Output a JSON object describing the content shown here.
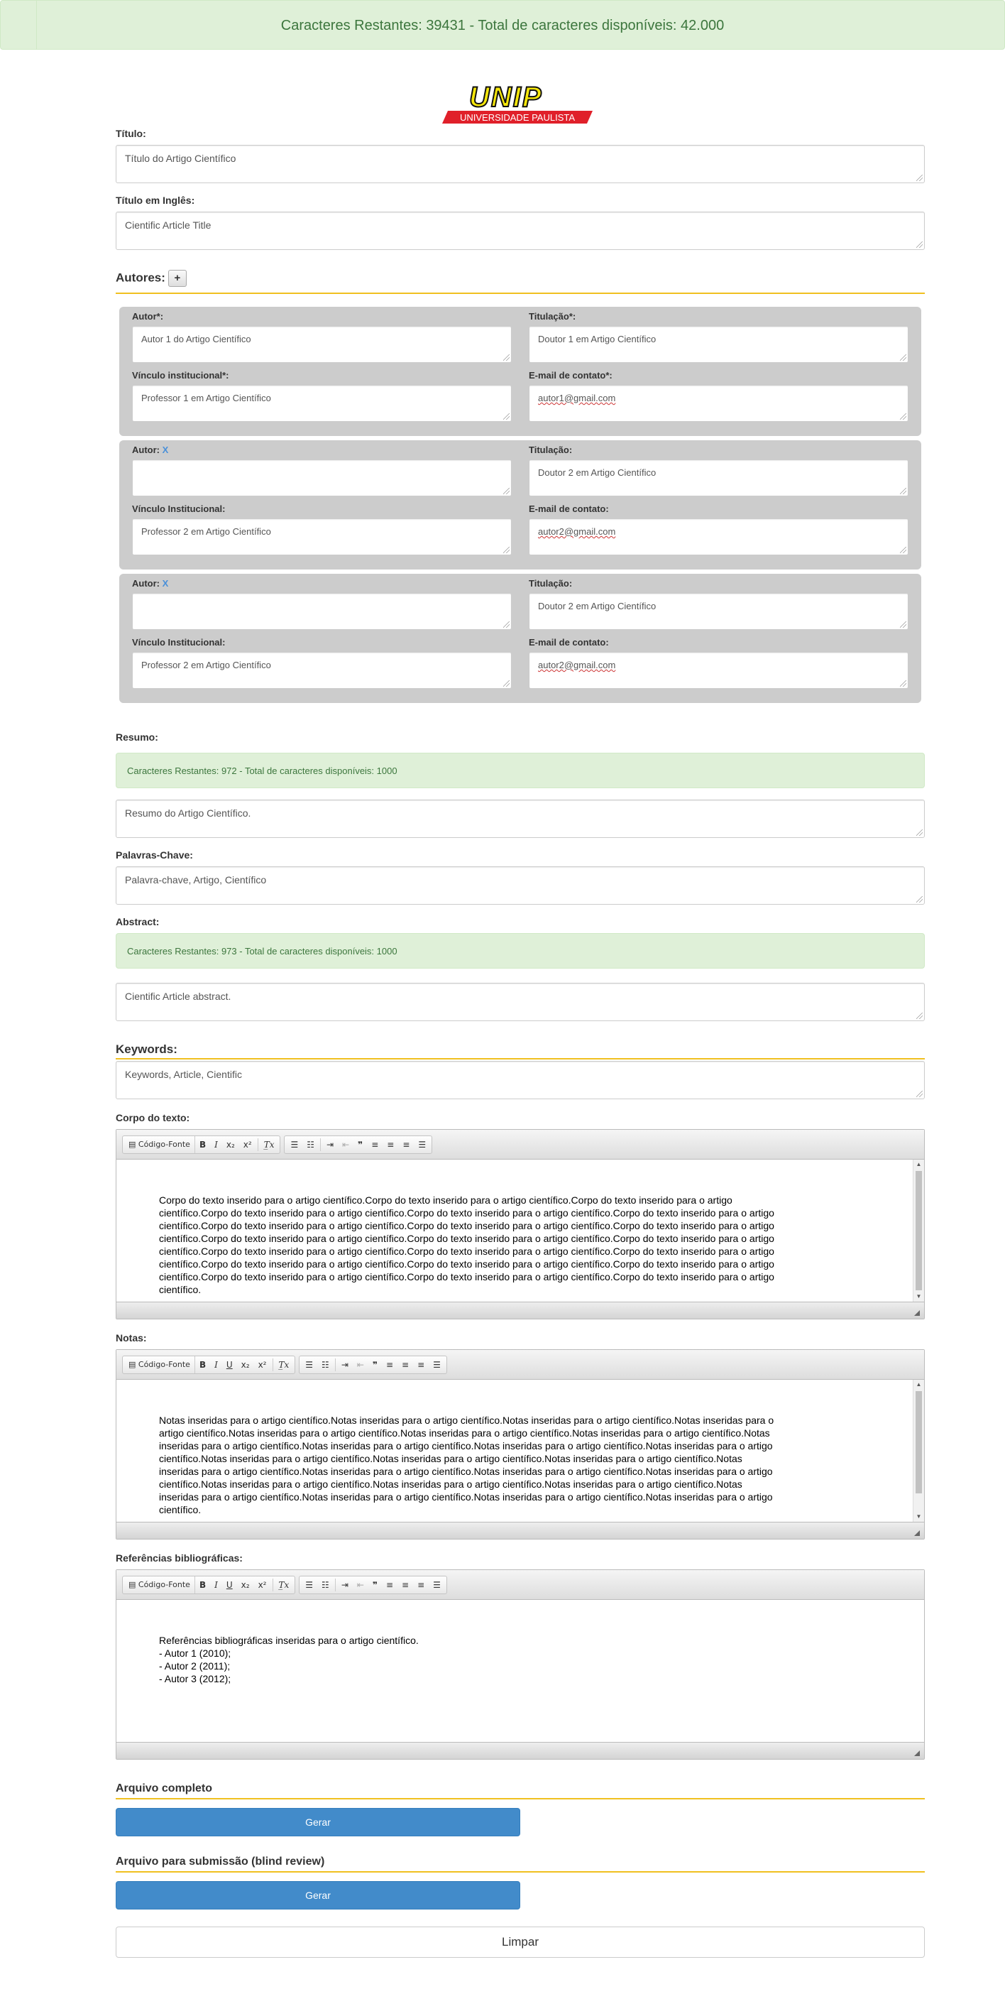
{
  "top_alert": "Caracteres Restantes: 39431 - Total de caracteres disponíveis: 42.000",
  "logo": {
    "main": "UNIP",
    "sub": "UNIVERSIDADE PAULISTA",
    "colors": {
      "yellow": "#f5e60a",
      "red": "#e0202a",
      "black": "#111111"
    }
  },
  "titulo": {
    "label": "Título:",
    "value": "Título do Artigo Científico"
  },
  "titulo_en": {
    "label": "Título em Inglês:",
    "value": "Cientific Article Title"
  },
  "autores": {
    "heading": "Autores:",
    "add_button": "+",
    "remove_label": "X",
    "blocks": [
      {
        "autor_label": "Autor*:",
        "autor": "Autor 1 do Artigo Científico",
        "titulacao_label": "Titulação*:",
        "titulacao": "Doutor 1 em Artigo Científico",
        "vinculo_label": "Vínculo institucional*:",
        "vinculo": "Professor 1 em Artigo Científico",
        "email_label": "E-mail de contato*:",
        "email": "autor1@gmail.com"
      },
      {
        "autor_label": "Autor:",
        "autor": "",
        "titulacao_label": "Titulação:",
        "titulacao": "Doutor 2 em Artigo Científico",
        "vinculo_label": "Vínculo Institucional:",
        "vinculo": "Professor 2 em Artigo Científico",
        "email_label": "E-mail de contato:",
        "email": "autor2@gmail.com"
      },
      {
        "autor_label": "Autor:",
        "autor": "",
        "titulacao_label": "Titulação:",
        "titulacao": "Doutor 2 em Artigo Científico",
        "vinculo_label": "Vínculo Institucional:",
        "vinculo": "Professor 2 em Artigo Científico",
        "email_label": "E-mail de contato:",
        "email": "autor2@gmail.com"
      }
    ]
  },
  "resumo": {
    "label": "Resumo:",
    "counter": "Caracteres Restantes: 972 - Total de caracteres disponíveis: 1000",
    "value": "Resumo do Artigo Científico."
  },
  "palavras": {
    "label": "Palavras-Chave:",
    "value": "Palavra-chave, Artigo, Científico"
  },
  "abstract": {
    "label": "Abstract:",
    "counter": "Caracteres Restantes: 973 - Total de caracteres disponíveis: 1000",
    "value": "Cientific Article abstract."
  },
  "keywords": {
    "heading": "Keywords:",
    "value": "Keywords, Article, Cientific"
  },
  "toolbar": {
    "source": "Código-Fonte",
    "bold": "B",
    "italic": "I",
    "underline": "U",
    "subscript": "x₂",
    "superscript": "x²",
    "clear": "T̲x",
    "quote": "❞"
  },
  "corpo": {
    "label": "Corpo do texto:",
    "lines": [
      "Corpo do texto inserido para o artigo científico.Corpo do texto inserido para o artigo científico.Corpo do texto inserido para o artigo",
      "científico.Corpo do texto inserido para o artigo científico.Corpo do texto inserido para o artigo científico.Corpo do texto inserido para o artigo",
      "científico.Corpo do texto inserido para o artigo científico.Corpo do texto inserido para o artigo científico.Corpo do texto inserido para o artigo",
      "científico.Corpo do texto inserido para o artigo científico.Corpo do texto inserido para o artigo científico.Corpo do texto inserido para o artigo",
      "científico.Corpo do texto inserido para o artigo científico.Corpo do texto inserido para o artigo científico.Corpo do texto inserido para o artigo",
      "científico.Corpo do texto inserido para o artigo científico.Corpo do texto inserido para o artigo científico.Corpo do texto inserido para o artigo",
      "científico.Corpo do texto inserido para o artigo científico.Corpo do texto inserido para o artigo científico.Corpo do texto inserido para o artigo",
      "científico."
    ]
  },
  "notas": {
    "label": "Notas:",
    "lines": [
      "Notas inseridas para o artigo científico.Notas inseridas para o artigo científico.Notas inseridas para o artigo científico.Notas inseridas para o",
      "artigo científico.Notas inseridas para o artigo científico.Notas inseridas para o artigo científico.Notas inseridas para o artigo científico.Notas",
      "inseridas para o artigo científico.Notas inseridas para o artigo científico.Notas inseridas para o artigo científico.Notas inseridas para o artigo",
      "científico.Notas inseridas para o artigo científico.Notas inseridas para o artigo científico.Notas inseridas para o artigo científico.Notas",
      "inseridas para o artigo científico.Notas inseridas para o artigo científico.Notas inseridas para o artigo científico.Notas inseridas para o artigo",
      "científico.Notas inseridas para o artigo científico.Notas inseridas para o artigo científico.Notas inseridas para o artigo científico.Notas",
      "inseridas para o artigo científico.Notas inseridas para o artigo científico.Notas inseridas para o artigo científico.Notas inseridas para o artigo",
      "científico."
    ]
  },
  "referencias": {
    "label": "Referências bibliográficas:",
    "lines": [
      "Referências bibliográficas inseridas para o artigo científico.",
      "- Autor 1 (2010);",
      "- Autor 2 (2011);",
      "- Autor 3 (2012);"
    ]
  },
  "arquivo_completo": {
    "heading": "Arquivo completo",
    "button": "Gerar"
  },
  "arquivo_blind": {
    "heading": "Arquivo para submissão (blind review)",
    "button": "Gerar"
  },
  "limpar": "Limpar"
}
